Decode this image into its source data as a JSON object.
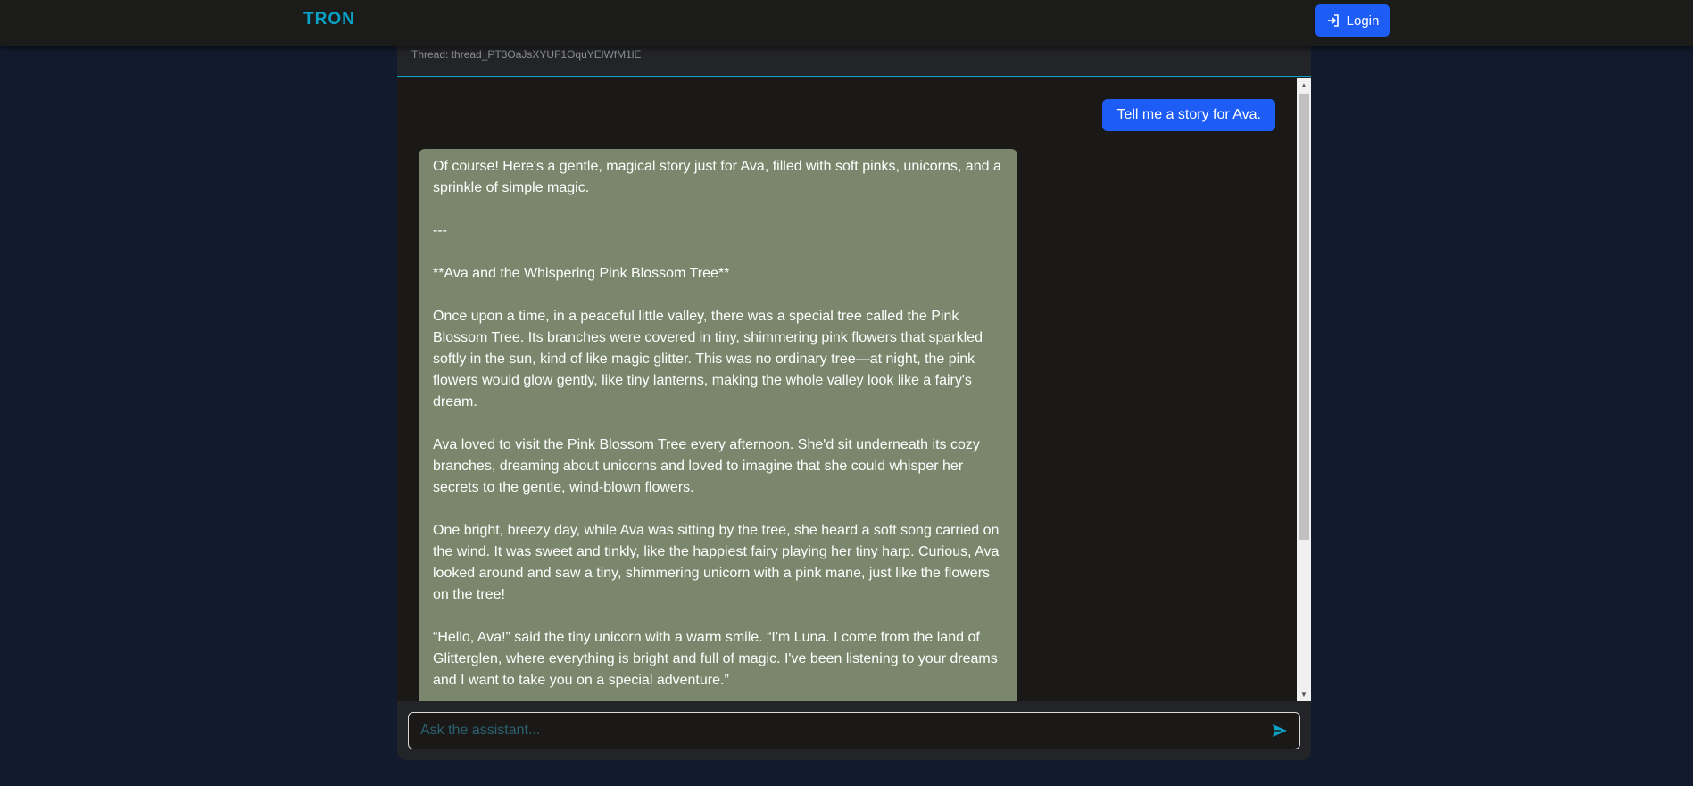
{
  "header": {
    "brand": "TRON",
    "login_label": "Login"
  },
  "thread": {
    "id_label": "Thread: thread_PT3OaJsXYUF1OquYElWfM1lE"
  },
  "messages": {
    "user": "Tell me a story for Ava.",
    "assistant": [
      "Of course! Here's a gentle, magical story just for Ava, filled with soft pinks, unicorns, and a sprinkle of simple magic.",
      "---",
      "**Ava and the Whispering Pink Blossom Tree**",
      "Once upon a time, in a peaceful little valley, there was a special tree called the Pink Blossom Tree. Its branches were covered in tiny, shimmering pink flowers that sparkled softly in the sun, kind of like magic glitter. This was no ordinary tree—at night, the pink flowers would glow gently, like tiny lanterns, making the whole valley look like a fairy's dream.",
      "Ava loved to visit the Pink Blossom Tree every afternoon. She'd sit underneath its cozy branches, dreaming about unicorns and loved to imagine that she could whisper her secrets to the gentle, wind-blown flowers.",
      "One bright, breezy day, while Ava was sitting by the tree, she heard a soft song carried on the wind. It was sweet and tinkly, like the happiest fairy playing her tiny harp. Curious, Ava looked around and saw a tiny, shimmering unicorn with a pink mane, just like the flowers on the tree!",
      "“Hello, Ava!” said the tiny unicorn with a warm smile. “I'm Luna. I come from the land of Glitterglen, where everything is bright and full of magic. I've been listening to your dreams and I want to take you on a special adventure.”"
    ]
  },
  "composer": {
    "placeholder": "Ask the assistant..."
  },
  "colors": {
    "accent": "#0aa1c4",
    "primary_button": "#1d5cf5",
    "assistant_bubble": "#7a876c",
    "page_background": "#121b2e"
  },
  "icons": {
    "login": "login-icon",
    "send": "send-icon"
  }
}
